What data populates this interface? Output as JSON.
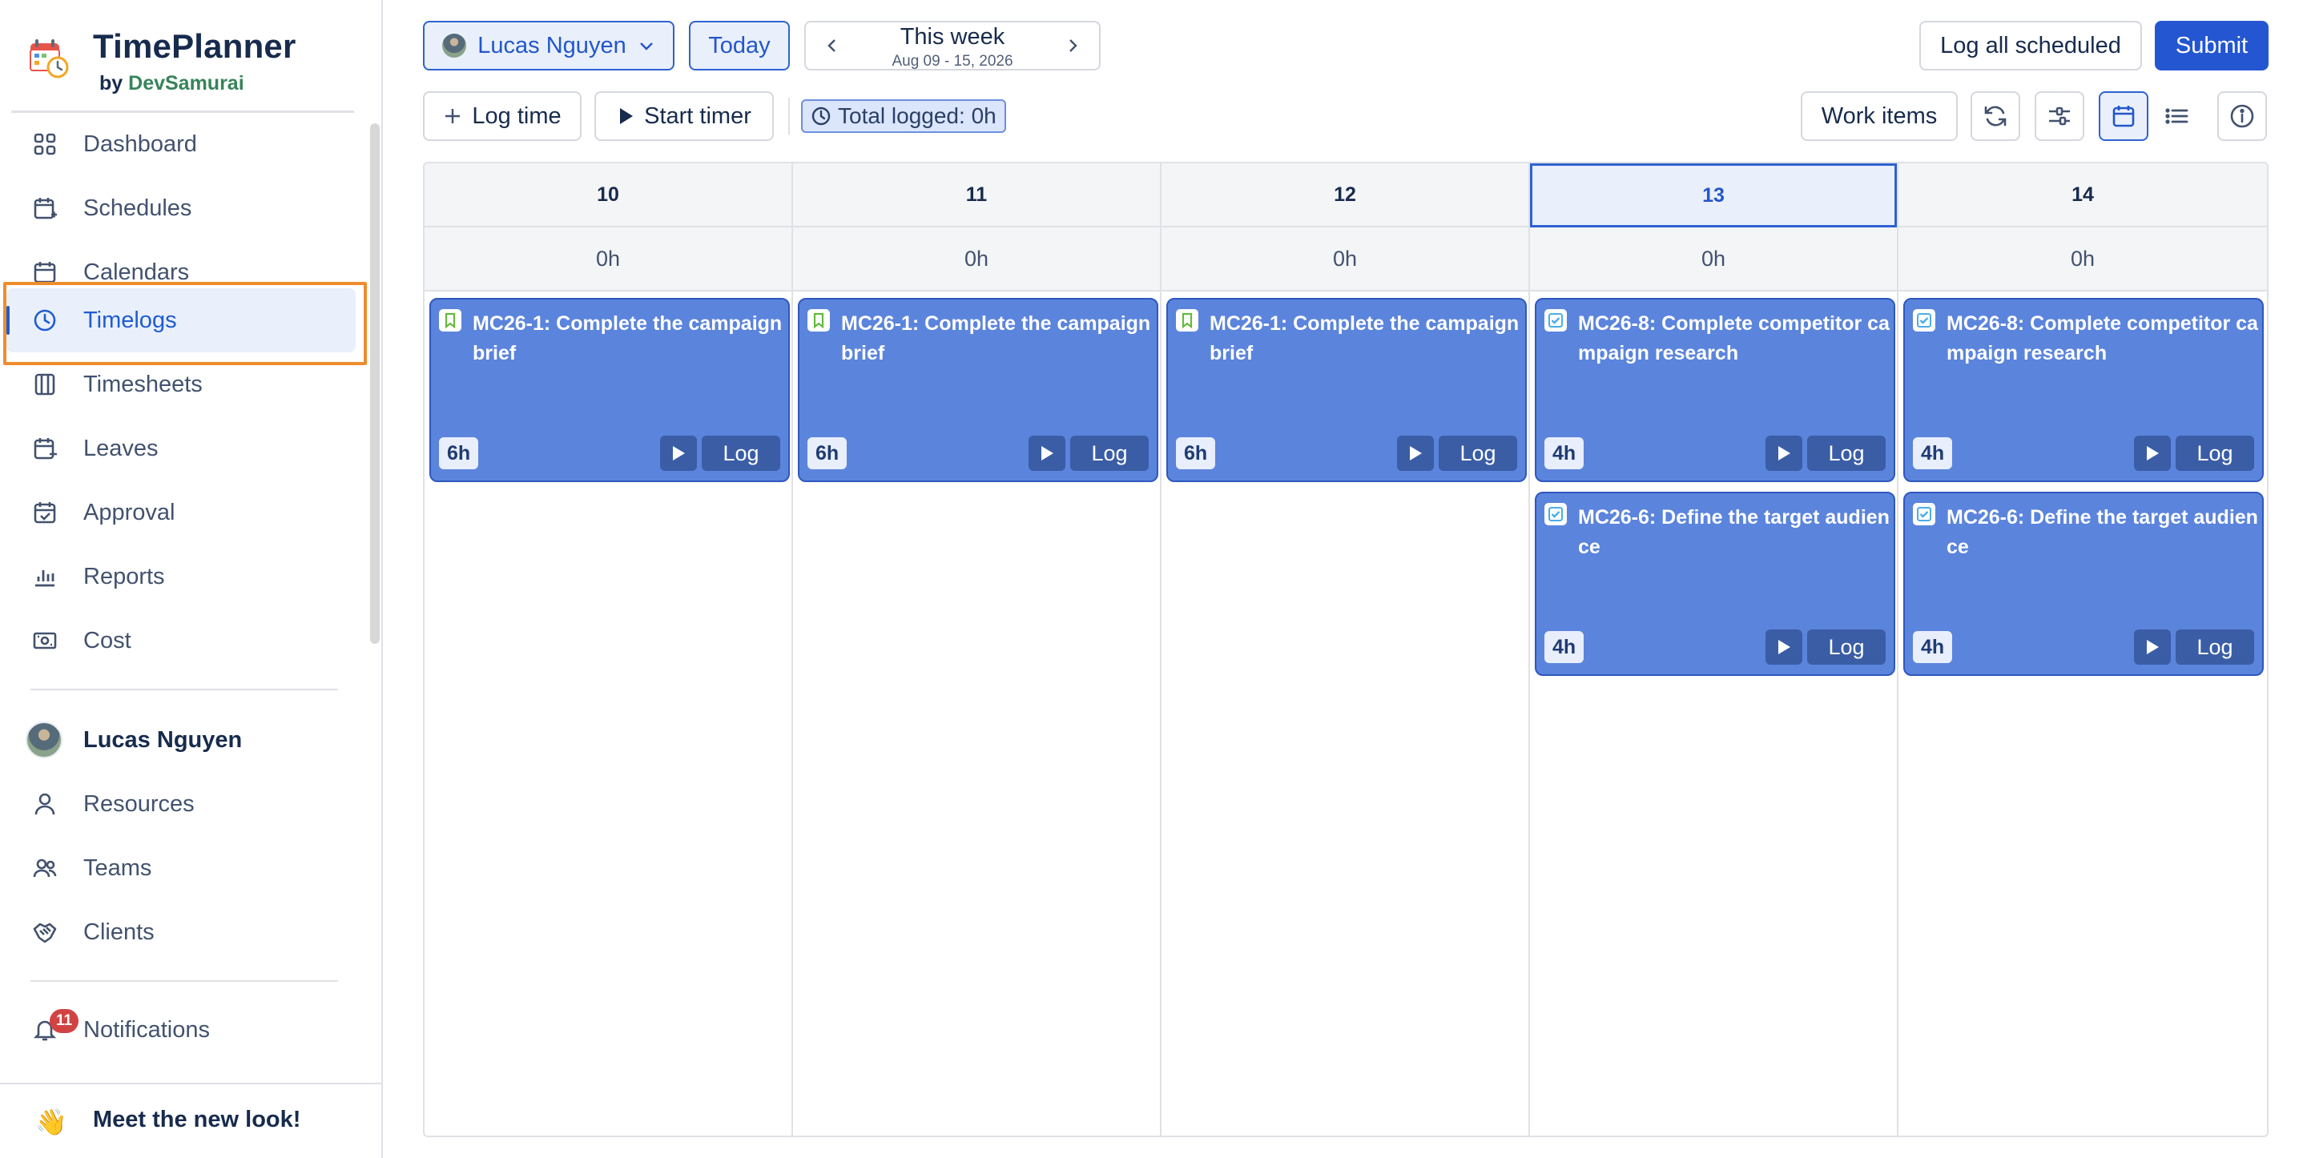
{
  "brand": {
    "title": "TimePlanner",
    "by": "by",
    "company": "DevSamurai"
  },
  "nav": [
    {
      "label": "Dashboard",
      "icon": "dashboard-icon"
    },
    {
      "label": "Schedules",
      "icon": "schedule-icon"
    },
    {
      "label": "Calendars",
      "icon": "calendar-icon"
    },
    {
      "label": "Timelogs",
      "icon": "clock-icon",
      "active": true
    },
    {
      "label": "Timesheets",
      "icon": "timesheet-icon"
    },
    {
      "label": "Leaves",
      "icon": "leave-icon"
    },
    {
      "label": "Approval",
      "icon": "approval-icon"
    },
    {
      "label": "Reports",
      "icon": "reports-icon"
    },
    {
      "label": "Cost",
      "icon": "cost-icon"
    }
  ],
  "user_section": {
    "user_name": "Lucas Nguyen",
    "items": [
      {
        "label": "Resources",
        "icon": "person-icon"
      },
      {
        "label": "Teams",
        "icon": "team-icon"
      },
      {
        "label": "Clients",
        "icon": "handshake-icon"
      }
    ]
  },
  "notifications": {
    "label": "Notifications",
    "count": "11"
  },
  "footer": {
    "emoji": "👋",
    "message": "Meet the new look!"
  },
  "toolbar": {
    "user_select": "Lucas Nguyen",
    "today": "Today",
    "week_title": "This week",
    "week_range": "Aug 09 - 15, 2026",
    "log_all": "Log all scheduled",
    "submit": "Submit",
    "log_time": "Log time",
    "start_timer": "Start timer",
    "total_logged": "Total logged: 0h",
    "work_items": "Work items"
  },
  "colors": {
    "accent": "#2456d1",
    "card": "#5b84dc",
    "highlight": "#f08c2c"
  },
  "calendar": {
    "days": [
      {
        "date": "10",
        "total": "0h",
        "cards": [
          {
            "kind": "story",
            "title": "MC26-1: Complete the campaign brief",
            "estimate": "6h",
            "log": "Log"
          }
        ]
      },
      {
        "date": "11",
        "total": "0h",
        "cards": [
          {
            "kind": "story",
            "title": "MC26-1: Complete the campaign brief",
            "estimate": "6h",
            "log": "Log"
          }
        ]
      },
      {
        "date": "12",
        "total": "0h",
        "cards": [
          {
            "kind": "story",
            "title": "MC26-1: Complete the campaign brief",
            "estimate": "6h",
            "log": "Log"
          }
        ]
      },
      {
        "date": "13",
        "total": "0h",
        "today": true,
        "cards": [
          {
            "kind": "task",
            "title": "MC26-8: Complete competitor campaign research",
            "estimate": "4h",
            "log": "Log"
          },
          {
            "kind": "task",
            "title": "MC26-6: Define the target audience",
            "estimate": "4h",
            "log": "Log"
          }
        ]
      },
      {
        "date": "14",
        "total": "0h",
        "cards": [
          {
            "kind": "task",
            "title": "MC26-8: Complete competitor campaign research",
            "estimate": "4h",
            "log": "Log"
          },
          {
            "kind": "task",
            "title": "MC26-6: Define the target audience",
            "estimate": "4h",
            "log": "Log"
          }
        ]
      }
    ]
  }
}
